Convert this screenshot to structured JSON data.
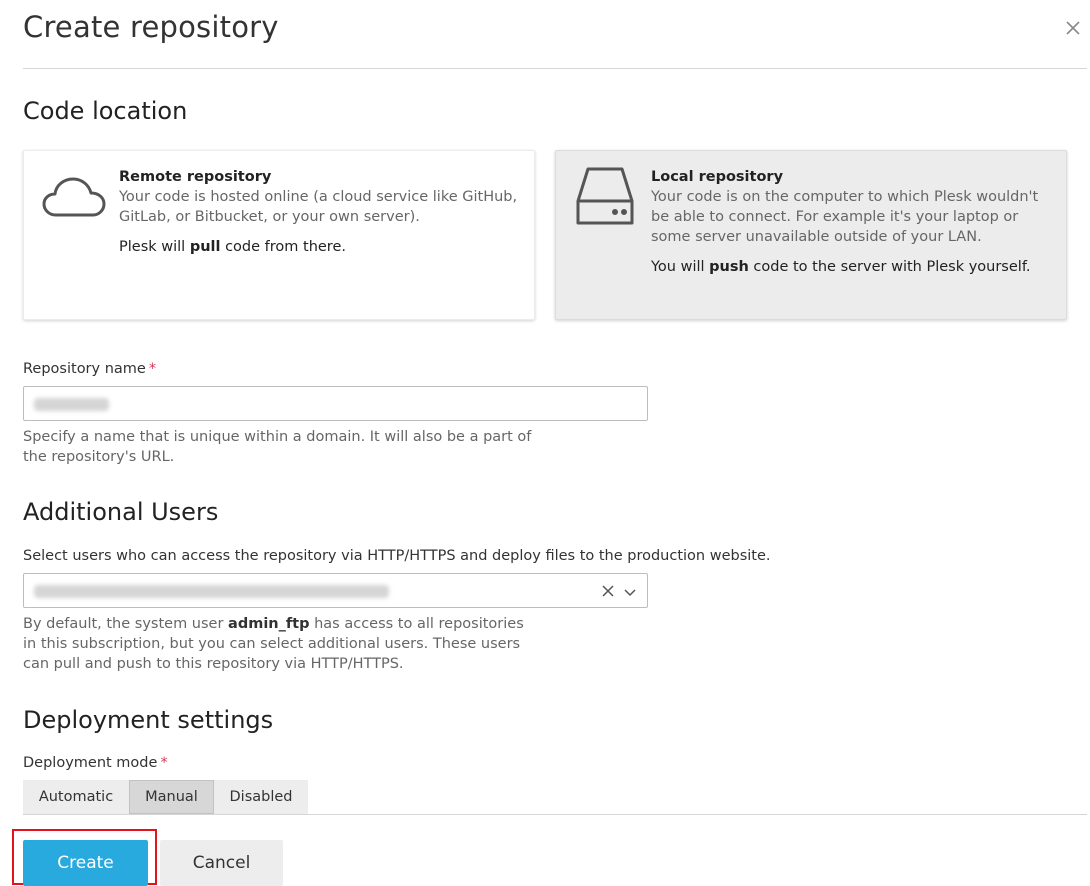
{
  "dialog": {
    "title": "Create repository"
  },
  "code_location": {
    "heading": "Code location",
    "remote": {
      "title": "Remote repository",
      "description": "Your code is hosted online (a cloud service like GitHub, GitLab, or Bitbucket, or your own server).",
      "note_before": "Plesk will ",
      "note_bold": "pull",
      "note_after": " code from there.",
      "icon": "cloud-icon"
    },
    "local": {
      "title": "Local repository",
      "description": "Your code is on the computer to which Plesk wouldn't be able to connect. For example it's your laptop or some server unavailable outside of your LAN.",
      "note_before": "You will ",
      "note_bold": "push",
      "note_after": " code to the server with Plesk yourself.",
      "icon": "hard-drive-icon",
      "selected": true
    }
  },
  "repository_name": {
    "label": "Repository name",
    "required_mark": "*",
    "hint": "Specify a name that is unique within a domain. It will also be a part of the repository's URL."
  },
  "additional_users": {
    "heading": "Additional Users",
    "label": "Select users who can access the repository via HTTP/HTTPS and deploy files to the production website.",
    "hint_before": "By default, the system user ",
    "hint_bold": "admin_ftp",
    "hint_after": " has access to all repositories in this subscription, but you can select additional users. These users can pull and push to this repository via HTTP/HTTPS."
  },
  "deployment": {
    "heading": "Deployment settings",
    "mode_label": "Deployment mode",
    "required_mark": "*",
    "modes": [
      "Automatic",
      "Manual",
      "Disabled"
    ],
    "selected_mode": "Manual"
  },
  "actions": {
    "create": "Create",
    "cancel": "Cancel"
  },
  "colors": {
    "primary": "#28aade",
    "required": "#d23a5d",
    "highlight": "#e0141a"
  }
}
